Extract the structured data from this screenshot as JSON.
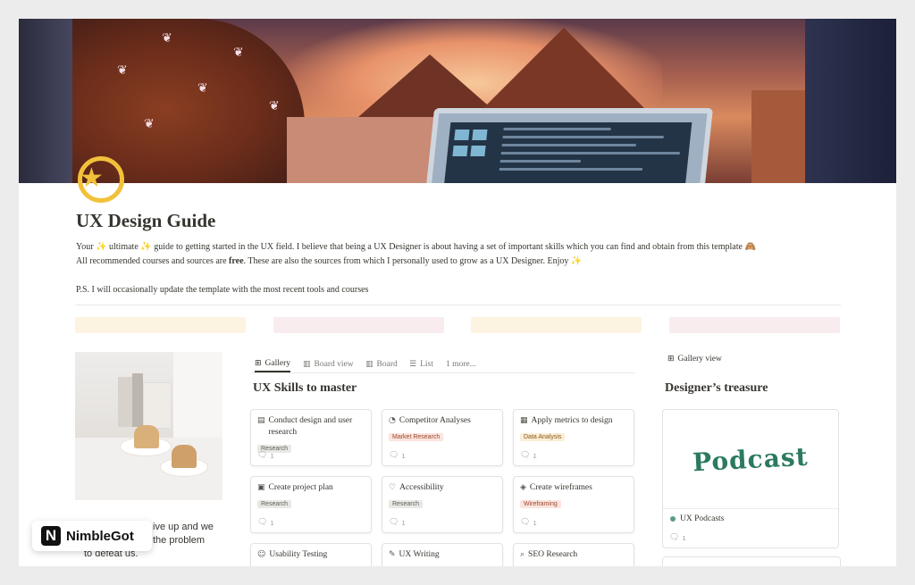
{
  "page": {
    "title": "UX Design Guide",
    "intro_line1": "Your ✨ ultimate ✨ guide to getting started in the UX field. I believe that being a UX Designer is about having a set of important skills which you can find and obtain from this template 🙈",
    "intro_line2_pre": "All recommended courses and sources are ",
    "intro_line2_bold": "free",
    "intro_line2_post": ". These are also the sources from which I personally used to grow as a UX Designer.  Enjoy ✨",
    "ps": "P.S. I will occasionally update the template with the most recent tools and courses"
  },
  "callout_colors": [
    "#fdf3e1",
    "#f8ecee",
    "#fdf3e1",
    "#f8ecee"
  ],
  "left_text": {
    "line1": "ive up and we",
    "line2": "the problem",
    "line3": "to defeat us."
  },
  "views": {
    "tabs": [
      {
        "label": "Gallery",
        "icon": "gallery-icon"
      },
      {
        "label": "Board view",
        "icon": "board-icon"
      },
      {
        "label": "Board",
        "icon": "board-icon"
      },
      {
        "label": "List",
        "icon": "list-icon"
      },
      {
        "label": "1 more...",
        "icon": ""
      }
    ]
  },
  "skills": {
    "title": "UX Skills to master",
    "cards": [
      {
        "title": "Conduct design and user research",
        "icon": "research-icon",
        "tag": "Research",
        "tag_bg": "#e9e8e5",
        "tag_color": "#5f5e5a",
        "comments": "1"
      },
      {
        "title": "Competitor Analyses",
        "icon": "analysis-icon",
        "tag": "Market Research",
        "tag_bg": "#fbe4dd",
        "tag_color": "#9c4a31",
        "comments": "1"
      },
      {
        "title": "Apply metrics to design",
        "icon": "chart-icon",
        "tag": "Data Analysis",
        "tag_bg": "#fbedd6",
        "tag_color": "#8a5a16",
        "comments": "1"
      },
      {
        "title": "Create project plan",
        "icon": "calendar-icon",
        "tag": "Research",
        "tag_bg": "#e9e8e5",
        "tag_color": "#5f5e5a",
        "comments": "1"
      },
      {
        "title": "Accessibility",
        "icon": "heart-icon",
        "tag": "Research",
        "tag_bg": "#e9e8e5",
        "tag_color": "#5f5e5a",
        "comments": "1"
      },
      {
        "title": "Create wireframes",
        "icon": "wireframe-icon",
        "tag": "Wireframing",
        "tag_bg": "#fbe4dd",
        "tag_color": "#9c4a31",
        "comments": "1"
      },
      {
        "title": "Usability Testing",
        "icon": "users-icon",
        "tag": "",
        "tag_bg": "",
        "tag_color": "",
        "comments": ""
      },
      {
        "title": "UX Writing",
        "icon": "pencil-icon",
        "tag": "",
        "tag_bg": "",
        "tag_color": "",
        "comments": ""
      },
      {
        "title": "SEO Research",
        "icon": "search-icon",
        "tag": "",
        "tag_bg": "",
        "tag_color": "",
        "comments": ""
      }
    ]
  },
  "treasure": {
    "tab_label": "Gallery view",
    "title": "Designer’s treasure",
    "card_cover_text": "Podcast",
    "card_name": "UX Podcasts",
    "card_comments": "1"
  },
  "brand": {
    "name": "NimbleGot",
    "logo_letter": "N"
  }
}
